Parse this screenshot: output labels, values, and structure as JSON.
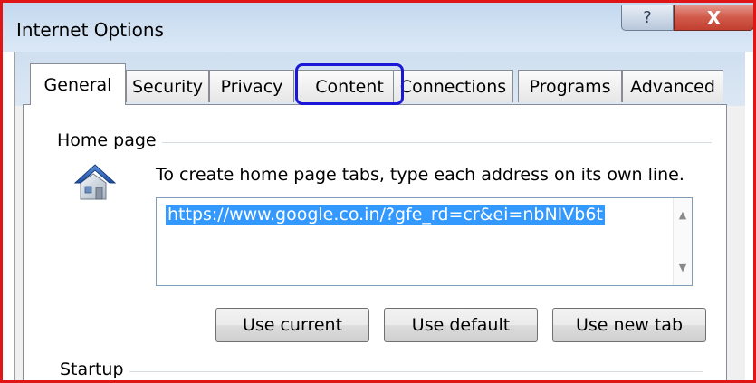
{
  "window": {
    "title": "Internet Options",
    "help_glyph": "?",
    "close_glyph": "X"
  },
  "tabs": [
    {
      "label": "General",
      "active": true
    },
    {
      "label": "Security"
    },
    {
      "label": "Privacy"
    },
    {
      "label": "Content",
      "highlighted": true
    },
    {
      "label": "Connections"
    },
    {
      "label": "Programs"
    },
    {
      "label": "Advanced"
    }
  ],
  "home_page": {
    "group_label": "Home page",
    "icon": "home-icon",
    "instruction": "To create home page tabs, type each address on its own line.",
    "url_value": "https://www.google.co.in/?gfe_rd=cr&ei=nbNIVb6t",
    "buttons": {
      "use_current": "Use current",
      "use_default": "Use default",
      "use_new_tab": "Use new tab"
    }
  },
  "startup": {
    "group_label": "Startup"
  },
  "colors": {
    "annotation_red": "#e01515",
    "highlight_blue": "#1a17d6",
    "selection_blue": "#3399ff"
  }
}
